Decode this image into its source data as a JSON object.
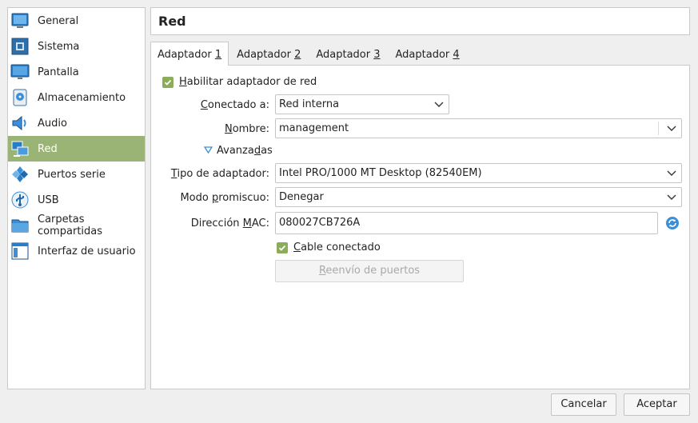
{
  "sidebar": {
    "items": [
      {
        "label": "General",
        "icon": "general-icon"
      },
      {
        "label": "Sistema",
        "icon": "system-icon"
      },
      {
        "label": "Pantalla",
        "icon": "display-icon"
      },
      {
        "label": "Almacenamiento",
        "icon": "storage-icon"
      },
      {
        "label": "Audio",
        "icon": "audio-icon"
      },
      {
        "label": "Red",
        "icon": "network-icon",
        "active": true
      },
      {
        "label": "Puertos serie",
        "icon": "serial-ports-icon"
      },
      {
        "label": "USB",
        "icon": "usb-icon"
      },
      {
        "label": "Carpetas compartidas",
        "icon": "shared-folders-icon"
      },
      {
        "label": "Interfaz de usuario",
        "icon": "user-interface-icon"
      }
    ]
  },
  "header": {
    "title": "Red"
  },
  "tabs": [
    {
      "label": "Adaptador ",
      "num": "1",
      "active": true
    },
    {
      "label": "Adaptador ",
      "num": "2"
    },
    {
      "label": "Adaptador ",
      "num": "3"
    },
    {
      "label": "Adaptador ",
      "num": "4"
    }
  ],
  "adapter": {
    "enable_label_ul": "H",
    "enable_label_rest": "abilitar adaptador de red",
    "enabled": true,
    "attached_label_pre": "C",
    "attached_label_rest": "onectado a:",
    "attached_value": "Red interna",
    "name_label_ul": "N",
    "name_label_rest": "ombre:",
    "name_value": "management",
    "advanced_label_pre": "Avanza",
    "advanced_label_ul": "d",
    "advanced_label_rest": "as",
    "type_label_pre": "T",
    "type_label_rest": "ipo de adaptador:",
    "type_value": "Intel PRO/1000 MT Desktop (82540EM)",
    "promisc_label_pre": "Modo ",
    "promisc_label_ul": "p",
    "promisc_label_rest": "romiscuo:",
    "promisc_value": "Denegar",
    "mac_label_pre": "Dirección ",
    "mac_label_ul": "M",
    "mac_label_rest": "AC:",
    "mac_value": "080027CB726A",
    "cable_label_ul": "C",
    "cable_label_rest": "able conectado",
    "cable_connected": true,
    "port_forward_ul": "R",
    "port_forward_rest": "eenvío de puertos"
  },
  "footer": {
    "cancel": "Cancelar",
    "ok": "Aceptar"
  },
  "colors": {
    "accent": "#99b474",
    "checkbox": "#8bad5a",
    "link_icon": "#3a8fd8"
  }
}
